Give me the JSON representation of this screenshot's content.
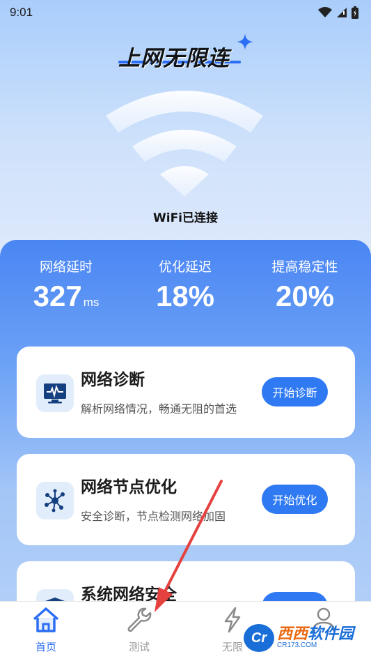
{
  "status_bar": {
    "time": "9:01"
  },
  "app": {
    "title": "上网无限连"
  },
  "wifi": {
    "status": "WiFi已连接"
  },
  "stats": [
    {
      "label": "网络延时",
      "value": "327",
      "unit": "ms"
    },
    {
      "label": "优化延迟",
      "value": "18%",
      "unit": ""
    },
    {
      "label": "提高稳定性",
      "value": "20%",
      "unit": ""
    }
  ],
  "cards": [
    {
      "title": "网络诊断",
      "desc": "解析网络情况，畅通无阻的首选",
      "button": "开始诊断",
      "icon": "monitor-icon"
    },
    {
      "title": "网络节点优化",
      "desc": "安全诊断，节点检测网络加固",
      "button": "开始优化",
      "icon": "network-nodes-icon"
    },
    {
      "title": "系统网络安全",
      "desc": "",
      "button": "",
      "icon": "shield-icon"
    }
  ],
  "nav": [
    {
      "label": "首页",
      "icon": "home-icon",
      "active": true
    },
    {
      "label": "测试",
      "icon": "wrench-icon",
      "active": false
    },
    {
      "label": "无限",
      "icon": "lightning-icon",
      "active": false
    },
    {
      "label": "",
      "icon": "user-icon",
      "active": false
    }
  ],
  "watermark": {
    "logo": "Cr",
    "main_a": "西西",
    "main_b": "软件园",
    "sub": "CR173.COM"
  },
  "colors": {
    "accent": "#2f7af3",
    "panel_top": "#4a86f3",
    "text_dark": "#1c1c1c"
  }
}
